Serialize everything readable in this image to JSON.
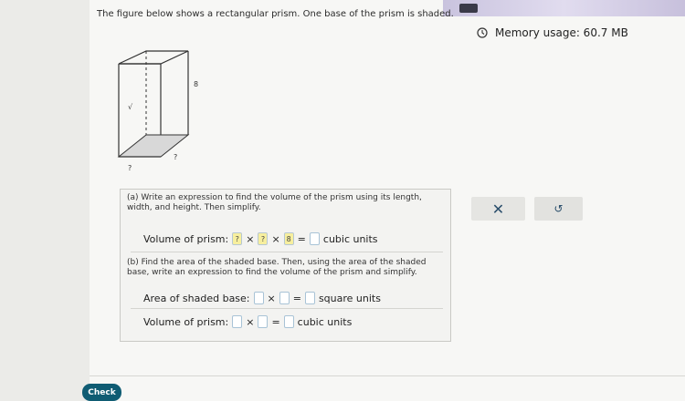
{
  "prompt_text": "The figure below shows a rectangular prism. One base of the prism is shaded.",
  "memory_usage": "Memory usage: 60.7 MB",
  "figure": {
    "label_height": "8",
    "label_width": "?",
    "label_depth": "?",
    "label_side": "√"
  },
  "part_a": {
    "instruction": "(a) Write an expression to find the volume of the prism using its length, width, and height. Then simplify.",
    "label_prefix": "Volume of prism:",
    "inputs": [
      "?",
      "?",
      "8",
      ""
    ],
    "suffix": "cubic units"
  },
  "part_b": {
    "instruction": "(b) Find the area of the shaded base. Then, using the area of the shaded base, write an expression to find the volume of the prism and simplify.",
    "area_label": "Area of shaded base:",
    "area_suffix": "square units",
    "volume_label": "Volume of prism:",
    "volume_suffix": "cubic units"
  },
  "buttons": {
    "clear": "✕",
    "undo": "↺",
    "check": "Check"
  }
}
